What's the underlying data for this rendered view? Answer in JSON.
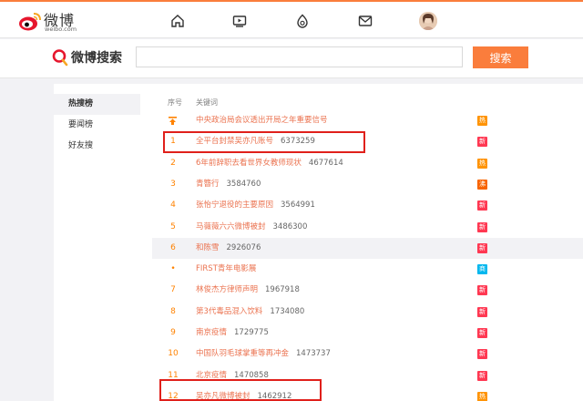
{
  "header": {
    "brand": "微博",
    "domain": "weibo.com",
    "nav": [
      "home-icon",
      "video-icon",
      "discover-icon",
      "message-icon"
    ]
  },
  "search": {
    "logo_text": "微博搜索",
    "value": "",
    "placeholder": "",
    "button": "搜索"
  },
  "sidebar": {
    "items": [
      {
        "label": "热搜榜",
        "active": true
      },
      {
        "label": "要闻榜",
        "active": false
      },
      {
        "label": "好友搜",
        "active": false
      }
    ]
  },
  "table": {
    "col_rank": "序号",
    "col_keyword": "关键词",
    "rows": [
      {
        "rank": "",
        "pinned": true,
        "keyword": "中央政治局会议透出开局之年重要信号",
        "heat": "",
        "badge": "热",
        "badge_type": "hot"
      },
      {
        "rank": "1",
        "keyword": "全平台封禁吴亦凡账号",
        "heat": "6373259",
        "badge": "新",
        "badge_type": "new"
      },
      {
        "rank": "2",
        "keyword": "6年前辞职去看世界女教师现状",
        "heat": "4677614",
        "badge": "热",
        "badge_type": "hot"
      },
      {
        "rank": "3",
        "keyword": "青簪行",
        "heat": "3584760",
        "badge": "沸",
        "badge_type": "boil"
      },
      {
        "rank": "4",
        "keyword": "张怡宁退役的主要原因",
        "heat": "3564991",
        "badge": "新",
        "badge_type": "new"
      },
      {
        "rank": "5",
        "keyword": "马薇薇六六微博被封",
        "heat": "3486300",
        "badge": "新",
        "badge_type": "new"
      },
      {
        "rank": "6",
        "keyword": "和陈雪",
        "heat": "2926076",
        "badge": "新",
        "badge_type": "new"
      },
      {
        "rank": "•",
        "keyword": "FIRST青年电影展",
        "heat": "",
        "badge": "商",
        "badge_type": "biz"
      },
      {
        "rank": "7",
        "keyword": "林俊杰方律师声明",
        "heat": "1967918",
        "badge": "新",
        "badge_type": "new"
      },
      {
        "rank": "8",
        "keyword": "第3代毒品混入饮料",
        "heat": "1734080",
        "badge": "新",
        "badge_type": "new"
      },
      {
        "rank": "9",
        "keyword": "南京疫情",
        "heat": "1729775",
        "badge": "新",
        "badge_type": "new"
      },
      {
        "rank": "10",
        "keyword": "中国队羽毛球掌重等再冲金",
        "heat": "1473737",
        "badge": "新",
        "badge_type": "new"
      },
      {
        "rank": "11",
        "keyword": "北京疫情",
        "heat": "1470858",
        "badge": "新",
        "badge_type": "new"
      },
      {
        "rank": "12",
        "keyword": "吴亦凡微博被封",
        "heat": "1462912",
        "badge": "热",
        "badge_type": "hot"
      }
    ]
  }
}
